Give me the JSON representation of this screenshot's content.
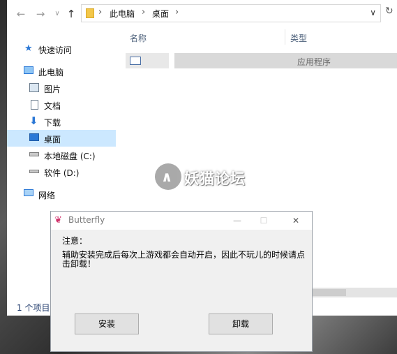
{
  "explorer": {
    "nav": {
      "back": "←",
      "forward": "→",
      "dropdown": "∨",
      "up": "↑",
      "refresh": "↻"
    },
    "breadcrumb": [
      "此电脑",
      "桌面"
    ],
    "sidebar": {
      "quick_access": "快速访问",
      "this_pc": "此电脑",
      "items": [
        "图片",
        "文档",
        "下载",
        "桌面",
        "本地磁盘 (C:)",
        "软件 (D:)"
      ],
      "network": "网络",
      "selected": "桌面"
    },
    "columns": {
      "name": "名称",
      "type": "类型"
    },
    "file": {
      "type": "应用程序"
    },
    "status": "1 个项目"
  },
  "watermark": {
    "mark": "∧",
    "text": "妖猫论坛"
  },
  "dialog": {
    "title": "Butterfly",
    "controls": {
      "minimize": "—",
      "maximize": "☐",
      "close": "✕"
    },
    "note_heading": "注意：",
    "message": "辅助安装完成后每次上游戏都会自动开启，因此不玩儿的时候请点击卸载！",
    "install_label": "安装",
    "uninstall_label": "卸载"
  },
  "icons": {
    "star": "quick-access-star-icon",
    "pc": "computer-icon",
    "pictures": "pictures-icon",
    "documents": "document-icon",
    "downloads": "download-arrow-icon",
    "desktop": "desktop-icon",
    "drive_c": "drive-icon",
    "drive_d": "drive-icon",
    "network": "network-icon",
    "butterfly": "butterfly-icon"
  },
  "colors": {
    "selection": "#cce8ff",
    "accent": "#1f3a6b",
    "folder": "#f3c74a",
    "butterfly": "#d0306a"
  }
}
